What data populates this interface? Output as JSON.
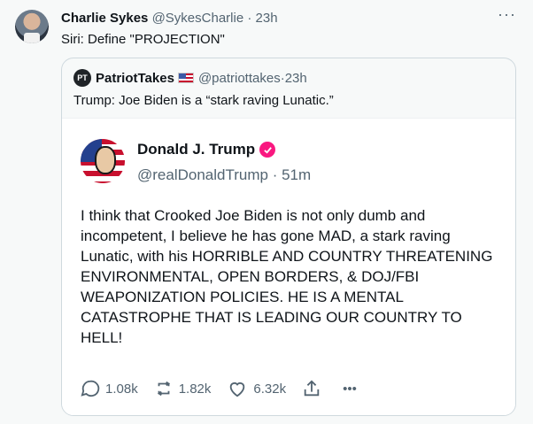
{
  "tweet": {
    "author_name": "Charlie Sykes",
    "author_handle": "@SykesCharlie",
    "time": "23h",
    "text": "Siri: Define \"PROJECTION\"",
    "more_glyph": "···"
  },
  "quote": {
    "logo_text": "PT",
    "author_name": "PatriotTakes",
    "flag_icon": "us-flag-icon",
    "author_handle": "@patriottakes",
    "time": "23h",
    "text": "Trump: Joe Biden is a “stark raving Lunatic.”"
  },
  "embedded": {
    "author_name": "Donald J. Trump",
    "verified_color": "#f91880",
    "author_handle": "@realDonaldTrump",
    "time": "51m",
    "text": "I think that Crooked Joe Biden is not only dumb and incompetent, I believe he has gone MAD, a stark raving Lunatic, with his HORRIBLE AND COUNTRY THREATENING ENVIRONMENTAL, OPEN BORDERS, & DOJ/FBI WEAPONIZATION POLICIES. HE IS A MENTAL CATASTROPHE THAT IS LEADING OUR COUNTRY TO HELL!",
    "actions": {
      "replies": "1.08k",
      "reposts": "1.82k",
      "likes": "6.32k",
      "more": "•••"
    }
  },
  "colors": {
    "text": "#0f1419",
    "muted": "#536471",
    "border": "#cfd9de"
  }
}
